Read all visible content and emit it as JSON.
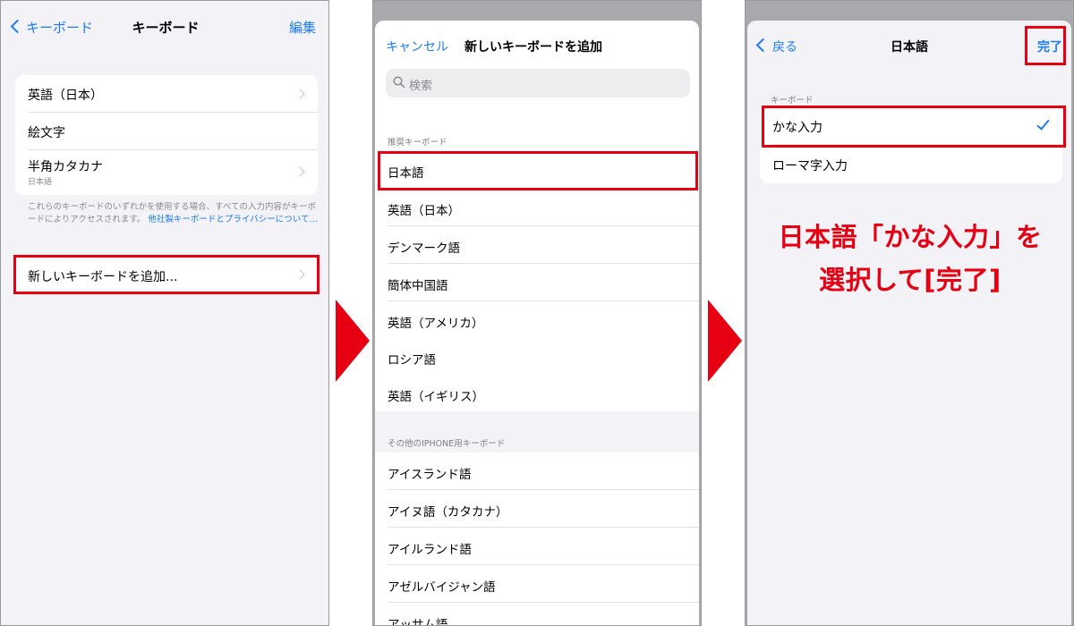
{
  "screen1": {
    "back_label": "キーボード",
    "title": "キーボード",
    "edit_label": "編集",
    "keyboards": [
      {
        "label": "英語（日本）",
        "sub": ""
      },
      {
        "label": "絵文字",
        "sub": ""
      },
      {
        "label": "半角カタカナ",
        "sub": "日本語"
      }
    ],
    "footnote_text": "これらのキーボードのいずれかを使用する場合、すべての入力内容がキーボードによりアクセスされます。",
    "footnote_link": "他社製キーボードとプライバシーについて…",
    "add_keyboard_label": "新しいキーボードを追加..."
  },
  "screen2": {
    "cancel_label": "キャンセル",
    "title": "新しいキーボードを追加",
    "search_placeholder": "検索",
    "suggested_header": "推奨キーボード",
    "suggested": [
      "日本語",
      "英語（日本）",
      "デンマーク語",
      "簡体中国語",
      "英語（アメリカ）",
      "ロシア語",
      "英語（イギリス）"
    ],
    "other_header": "その他のIPHONE用キーボード",
    "other": [
      "アイスランド語",
      "アイヌ語（カタカナ）",
      "アイルランド語",
      "アゼルバイジャン語",
      "アッサム語"
    ]
  },
  "screen3": {
    "back_label": "戻る",
    "title": "日本語",
    "done_label": "完了",
    "section_header": "キーボード",
    "options": [
      {
        "label": "かな入力",
        "selected": true
      },
      {
        "label": "ローマ字入力",
        "selected": false
      }
    ]
  },
  "caption": {
    "line1": "日本語「かな入力」を",
    "line2": "選択して[完了]"
  },
  "colors": {
    "accent": "#1a7cf5",
    "highlight": "#e60012"
  },
  "icons": {
    "chevron": "chevron-right-icon",
    "back": "chevron-left-icon",
    "search": "search-icon",
    "check": "checkmark-icon",
    "step_arrow": "arrow-right-icon"
  }
}
